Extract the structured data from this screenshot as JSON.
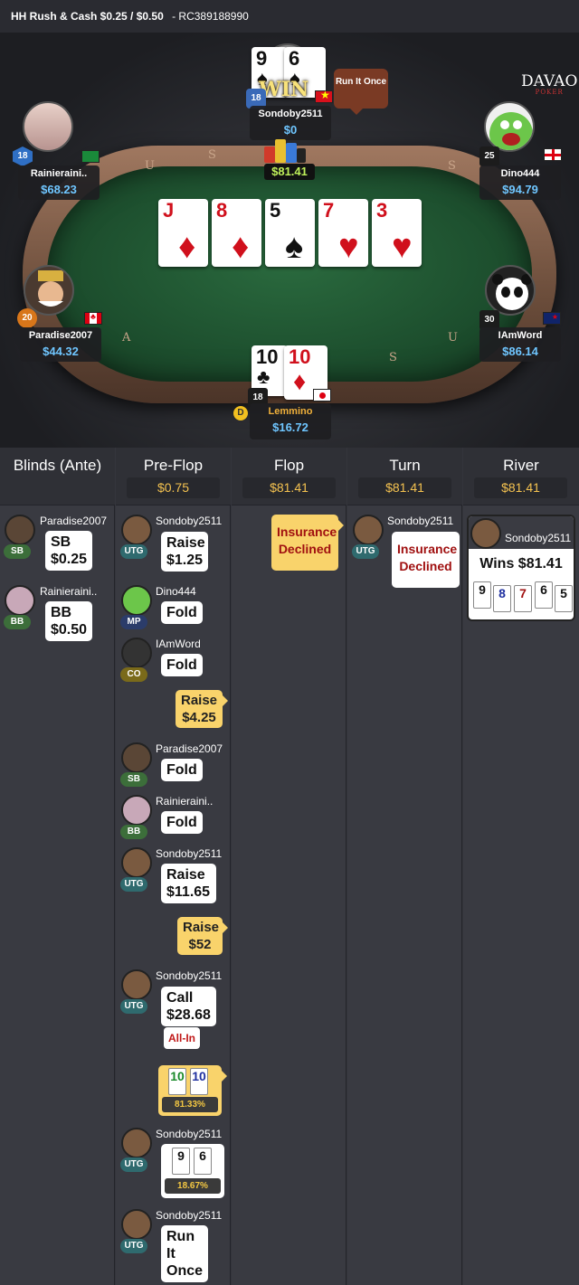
{
  "header": {
    "title": "HH  Rush & Cash $0.25 / $0.50",
    "code": "- RC389188990"
  },
  "logo": {
    "main": "DAVAO",
    "sub": "POKER"
  },
  "run_bubble": "Run It Once",
  "win_text": "WIN",
  "pot": "$81.41",
  "rail_letters": [
    "U",
    "S",
    "A",
    "S",
    "U",
    "S"
  ],
  "board": [
    {
      "rank": "J",
      "suit": "♦",
      "color": "red"
    },
    {
      "rank": "8",
      "suit": "♦",
      "color": "red"
    },
    {
      "rank": "5",
      "suit": "♠",
      "color": "blk"
    },
    {
      "rank": "7",
      "suit": "♥",
      "color": "red"
    },
    {
      "rank": "3",
      "suit": "♥",
      "color": "red"
    }
  ],
  "seats": {
    "top": {
      "name": "Sondoby2511",
      "stack": "$0",
      "level": "18",
      "cards": [
        {
          "rank": "9",
          "suit": "♠"
        },
        {
          "rank": "6",
          "suit": "♠"
        }
      ]
    },
    "left_top": {
      "name": "Rainieraini..",
      "stack": "$68.23",
      "level": "18"
    },
    "right_top": {
      "name": "Dino444",
      "stack": "$94.79",
      "level": "25"
    },
    "left_bottom": {
      "name": "Paradise2007",
      "stack": "$44.32",
      "level": "20"
    },
    "right_bottom": {
      "name": "IAmWord",
      "stack": "$86.14",
      "level": "30"
    },
    "hero": {
      "name": "Lemmino",
      "stack": "$16.72",
      "level": "18",
      "dealer": "D",
      "cards": [
        {
          "rank": "10",
          "suit": "♣",
          "color": "blk"
        },
        {
          "rank": "10",
          "suit": "♦",
          "color": "red"
        }
      ]
    }
  },
  "columns": [
    {
      "title": "Blinds (Ante)",
      "pot": ""
    },
    {
      "title": "Pre-Flop",
      "pot": "$0.75"
    },
    {
      "title": "Flop",
      "pot": "$81.41"
    },
    {
      "title": "Turn",
      "pot": "$81.41"
    },
    {
      "title": "River",
      "pot": "$81.41"
    }
  ],
  "blinds": [
    {
      "name": "Paradise2007",
      "pos": "SB",
      "action": "SB",
      "amount": "$0.25"
    },
    {
      "name": "Rainieraini..",
      "pos": "BB",
      "action": "BB",
      "amount": "$0.50"
    }
  ],
  "preflop": [
    {
      "name": "Sondoby2511",
      "pos": "UTG",
      "action": "Raise",
      "amount": "$1.25"
    },
    {
      "name": "Dino444",
      "pos": "MP",
      "action": "Fold",
      "amount": ""
    },
    {
      "name": "IAmWord",
      "pos": "CO",
      "action": "Fold",
      "amount": ""
    },
    {
      "hero_action": "Raise",
      "hero_amount": "$4.25"
    },
    {
      "name": "Paradise2007",
      "pos": "SB",
      "action": "Fold",
      "amount": ""
    },
    {
      "name": "Rainieraini..",
      "pos": "BB",
      "action": "Fold",
      "amount": ""
    },
    {
      "name": "Sondoby2511",
      "pos": "UTG",
      "action": "Raise",
      "amount": "$11.65"
    },
    {
      "hero_action": "Raise",
      "hero_amount": "$52"
    },
    {
      "name": "Sondoby2511",
      "pos": "UTG",
      "action": "Call",
      "amount": "$28.68"
    },
    {
      "allin": "All-In"
    },
    {
      "hero_cards": [
        "10",
        "10"
      ],
      "hero_equity": "81.33%"
    },
    {
      "name": "Sondoby2511",
      "pos": "UTG",
      "cards": [
        "9",
        "6"
      ],
      "equity": "18.67%"
    },
    {
      "name": "Sondoby2511",
      "pos": "UTG",
      "action": "Run It",
      "amount": "Once"
    }
  ],
  "flop": {
    "hero": "Insurance Declined"
  },
  "turn": {
    "name": "Sondoby2511",
    "pos": "UTG",
    "action": "Insurance Declined"
  },
  "river": {
    "name": "Sondoby2511",
    "result": "Wins $81.41",
    "cards": [
      "9",
      "8",
      "7",
      "6",
      "5"
    ]
  }
}
